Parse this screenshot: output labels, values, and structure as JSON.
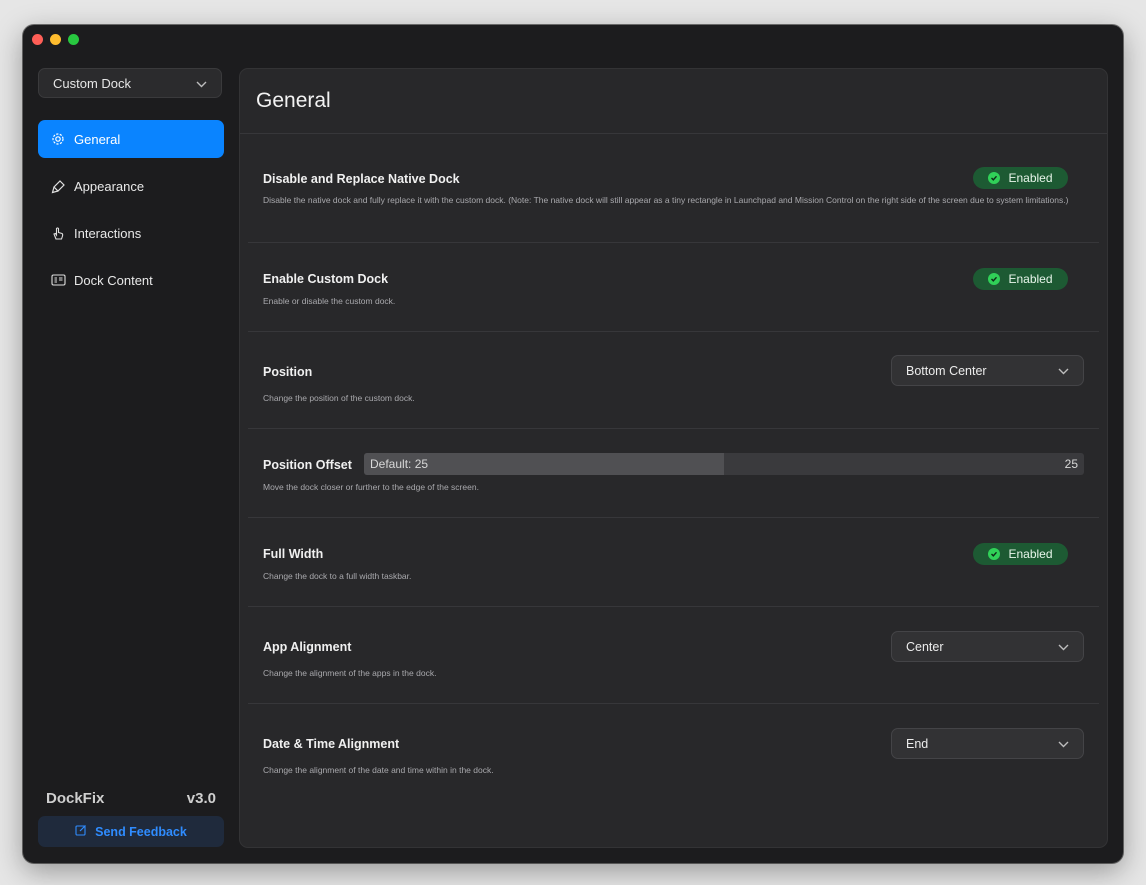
{
  "sidebar": {
    "profile_select": "Custom Dock",
    "items": [
      {
        "label": "General",
        "icon": "gear-icon"
      },
      {
        "label": "Appearance",
        "icon": "paintbrush-icon"
      },
      {
        "label": "Interactions",
        "icon": "hand-pointer-icon"
      },
      {
        "label": "Dock Content",
        "icon": "list-icon"
      }
    ],
    "app_name": "DockFix",
    "version": "v3.0",
    "feedback_label": "Send Feedback"
  },
  "main": {
    "title": "General",
    "settings": [
      {
        "title": "Disable and Replace Native Dock",
        "desc": "Disable the native dock and fully replace it with the custom dock. (Note: The native dock will still appear as a tiny rectangle in Launchpad and Mission Control on the right side of the screen due to system limitations.)",
        "control": "toggle",
        "value": "Enabled"
      },
      {
        "title": "Enable Custom Dock",
        "desc": "Enable or disable the custom dock.",
        "control": "toggle",
        "value": "Enabled"
      },
      {
        "title": "Position",
        "desc": "Change the position of the custom dock.",
        "control": "select",
        "value": "Bottom Center"
      },
      {
        "title": "Position Offset",
        "desc": "Move the dock closer or further to the edge of the screen.",
        "control": "slider",
        "placeholder": "Default: 25",
        "value": "25",
        "fill_fraction": 0.5
      },
      {
        "title": "Full Width",
        "desc": "Change the dock to a full width taskbar.",
        "control": "toggle",
        "value": "Enabled"
      },
      {
        "title": "App Alignment",
        "desc": "Change the alignment of the apps in the dock.",
        "control": "select",
        "value": "Center"
      },
      {
        "title": "Date & Time Alignment",
        "desc": "Change the alignment of the date and time within in the dock.",
        "control": "select",
        "value": "End"
      }
    ]
  },
  "colors": {
    "accent": "#0a84ff",
    "enabled_badge": "#1d5a33",
    "enabled_dot": "#30d158"
  }
}
